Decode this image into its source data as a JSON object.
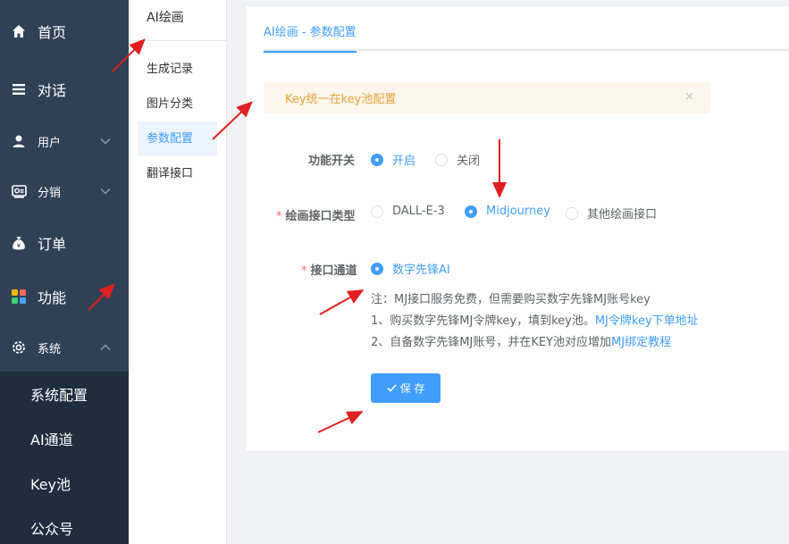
{
  "sidebar": {
    "items": [
      {
        "label": "首页",
        "icon": "home-icon"
      },
      {
        "label": "对话",
        "icon": "menu-icon"
      },
      {
        "label": "用户",
        "icon": "user-icon"
      },
      {
        "label": "分销",
        "icon": "distribution-icon"
      },
      {
        "label": "订单",
        "icon": "money-bag-icon"
      },
      {
        "label": "功能",
        "icon": "apps-icon"
      },
      {
        "label": "系统",
        "icon": "gear-icon"
      }
    ],
    "system_sub": [
      "系统配置",
      "AI通道",
      "Key池",
      "公众号"
    ]
  },
  "subnav": {
    "title": "AI绘画",
    "items": [
      "生成记录",
      "图片分类",
      "参数配置",
      "翻译接口"
    ],
    "active_index": 2
  },
  "main": {
    "tab": "AI绘画 - 参数配置",
    "alert": "Key统一在key池配置",
    "alert_close": "×",
    "switch_label": "功能开关",
    "switch_on": "开启",
    "switch_off": "关闭",
    "type_label": "绘画接口类型",
    "type_options": [
      "DALL-E-3",
      "Midjourney",
      "其他绘画接口"
    ],
    "channel_label": "接口通道",
    "channel_option": "数字先锋AI",
    "note1": "注：MJ接口服务免费，但需要购买数字先锋MJ账号key",
    "note2_text": "1、购买数字先锋MJ令牌key，填到key池。",
    "note2_link": "MJ令牌key下单地址",
    "note3_text": "2、自备数字先锋MJ账号，并在KEY池对应增加",
    "note3_link": "MJ绑定教程",
    "save_label": "保 存",
    "required_mark": "*"
  },
  "colors": {
    "sidebar_bg": "#304156",
    "submenu_bg": "#1f2d3d",
    "primary": "#409eff",
    "warning": "#e6a23c",
    "arrow": "#e02020"
  }
}
